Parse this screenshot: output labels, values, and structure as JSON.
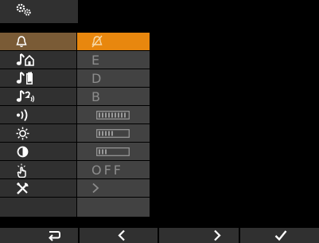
{
  "header": {
    "icon": "settings-gears-icon"
  },
  "menu": {
    "selected_index": 0,
    "rows": [
      {
        "name": "ringtone-settings",
        "icon": "bell-icon",
        "value_icon": "bell-muted-icon"
      },
      {
        "name": "floor-call-tone",
        "icon": "note-house-icon",
        "value": "E"
      },
      {
        "name": "door-call-tone",
        "icon": "note-door-icon",
        "value": "D"
      },
      {
        "name": "intercom-tone",
        "icon": "note-intercom-icon",
        "value": "B"
      },
      {
        "name": "ring-volume",
        "icon": "sound-waves-icon",
        "value_icon": "level-bar-full-icon",
        "level": 1.0
      },
      {
        "name": "brightness",
        "icon": "sun-icon",
        "value_icon": "level-bar-half-icon",
        "level": 0.55
      },
      {
        "name": "contrast",
        "icon": "contrast-icon",
        "value_icon": "level-bar-low-icon",
        "level": 0.3
      },
      {
        "name": "key-tone",
        "icon": "touch-hand-icon",
        "value": "OFF"
      },
      {
        "name": "advanced-settings",
        "icon": "tools-icon",
        "value_icon": "chevron-right-icon"
      }
    ]
  },
  "bottombar": {
    "buttons": [
      {
        "name": "back-button",
        "icon": "return-arrow-icon"
      },
      {
        "name": "previous-button",
        "icon": "chevron-left-icon"
      },
      {
        "name": "next-button",
        "icon": "chevron-right-icon"
      },
      {
        "name": "confirm-button",
        "icon": "checkmark-icon"
      }
    ]
  },
  "colors": {
    "background": "#000000",
    "panel": "#303030",
    "value_panel": "#424242",
    "selected_value": "#e8870e",
    "selected_icon_cell": "#7a5b36",
    "muted_text": "#8c8c8c",
    "icon_white": "#ffffff"
  }
}
